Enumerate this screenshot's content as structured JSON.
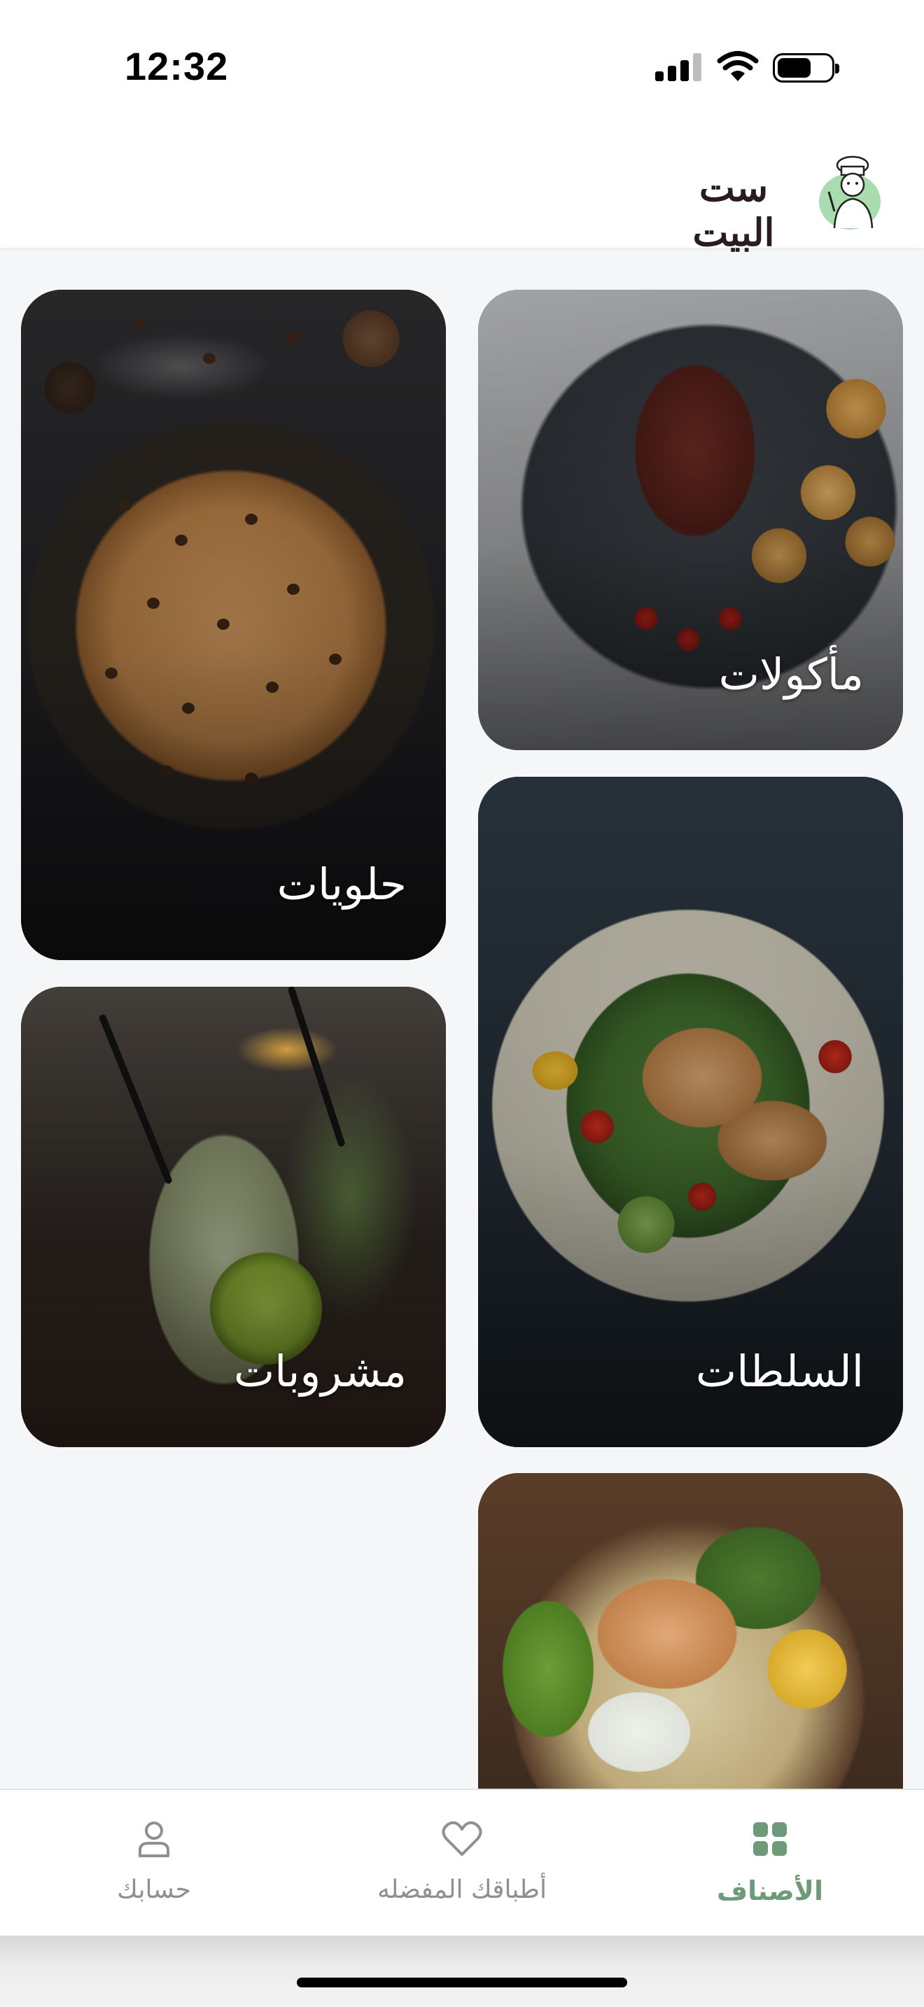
{
  "status_bar": {
    "time": "12:32"
  },
  "header": {
    "brand_name": "ست البيت",
    "logo_icon": "chef-icon"
  },
  "categories": [
    {
      "label": "مأكولات"
    },
    {
      "label": "حلويات"
    },
    {
      "label": "السلطات"
    },
    {
      "label": "مشروبات"
    },
    {
      "label": ""
    }
  ],
  "tab_bar": {
    "tabs": [
      {
        "label": "الأصناف",
        "icon": "grid-icon",
        "active": true
      },
      {
        "label": "أطباقك المفضله",
        "icon": "heart-icon",
        "active": false
      },
      {
        "label": "حسابك",
        "icon": "user-icon",
        "active": false
      }
    ]
  },
  "colors": {
    "accent": "#6e9a7a",
    "inactive": "#8e8e93",
    "background": "#f5f6f7"
  }
}
